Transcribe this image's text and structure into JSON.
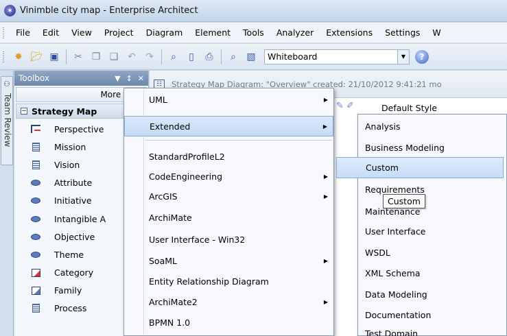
{
  "window": {
    "title": "Vinimble city map - Enterprise Architect"
  },
  "menubar": [
    "File",
    "Edit",
    "View",
    "Project",
    "Diagram",
    "Element",
    "Tools",
    "Analyzer",
    "Extensions",
    "Settings",
    "W"
  ],
  "toolbar": {
    "view_combo_value": "Whiteboard"
  },
  "side_tab": {
    "label": "Team Review"
  },
  "toolbox": {
    "title": "Toolbox",
    "pin_glyph": "▾ p",
    "more_tools": "More tools",
    "group": "Strategy Map",
    "items": [
      {
        "label": "Perspective",
        "icon": "perspective-icon"
      },
      {
        "label": "Mission",
        "icon": "document-icon"
      },
      {
        "label": "Vision",
        "icon": "document-icon"
      },
      {
        "label": "Attribute",
        "icon": "ellipse-icon"
      },
      {
        "label": "Initiative",
        "icon": "ellipse-icon"
      },
      {
        "label": "Intangible A",
        "icon": "ellipse-icon"
      },
      {
        "label": "Objective",
        "icon": "ellipse-icon"
      },
      {
        "label": "Theme",
        "icon": "ellipse-icon"
      },
      {
        "label": "Category",
        "icon": "category-icon"
      },
      {
        "label": "Family",
        "icon": "family-icon"
      },
      {
        "label": "Process",
        "icon": "document-icon"
      }
    ]
  },
  "diagram": {
    "caption": "Strategy Map Diagram: \"Overview\"   created: 21/10/2012 9:41:21 mo",
    "style_label": "Default Style"
  },
  "context_menu": {
    "items": [
      {
        "label": "UML",
        "submenu": true
      },
      {
        "label": "Extended",
        "submenu": true,
        "highlighted": true
      },
      {
        "label": "StandardProfileL2",
        "submenu": false
      },
      {
        "label": "CodeEngineering",
        "submenu": true
      },
      {
        "label": "ArcGIS",
        "submenu": true
      },
      {
        "label": "ArchiMate",
        "submenu": false
      },
      {
        "label": "User Interface - Win32",
        "submenu": false
      },
      {
        "label": "SoaML",
        "submenu": true
      },
      {
        "label": "Entity Relationship Diagram",
        "submenu": false
      },
      {
        "label": "ArchiMate2",
        "submenu": true
      },
      {
        "label": "BPMN 1.0",
        "submenu": false
      }
    ]
  },
  "submenu": {
    "items": [
      {
        "label": "Analysis"
      },
      {
        "label": "Business Modeling"
      },
      {
        "label": "Custom",
        "highlighted": true
      },
      {
        "label": "Requirements"
      },
      {
        "label": "Maintenance"
      },
      {
        "label": "User Interface"
      },
      {
        "label": "WSDL"
      },
      {
        "label": "XML Schema"
      },
      {
        "label": "Data Modeling"
      },
      {
        "label": "Documentation"
      },
      {
        "label": "Test Domain"
      }
    ]
  },
  "tooltip": {
    "text": "Custom"
  }
}
